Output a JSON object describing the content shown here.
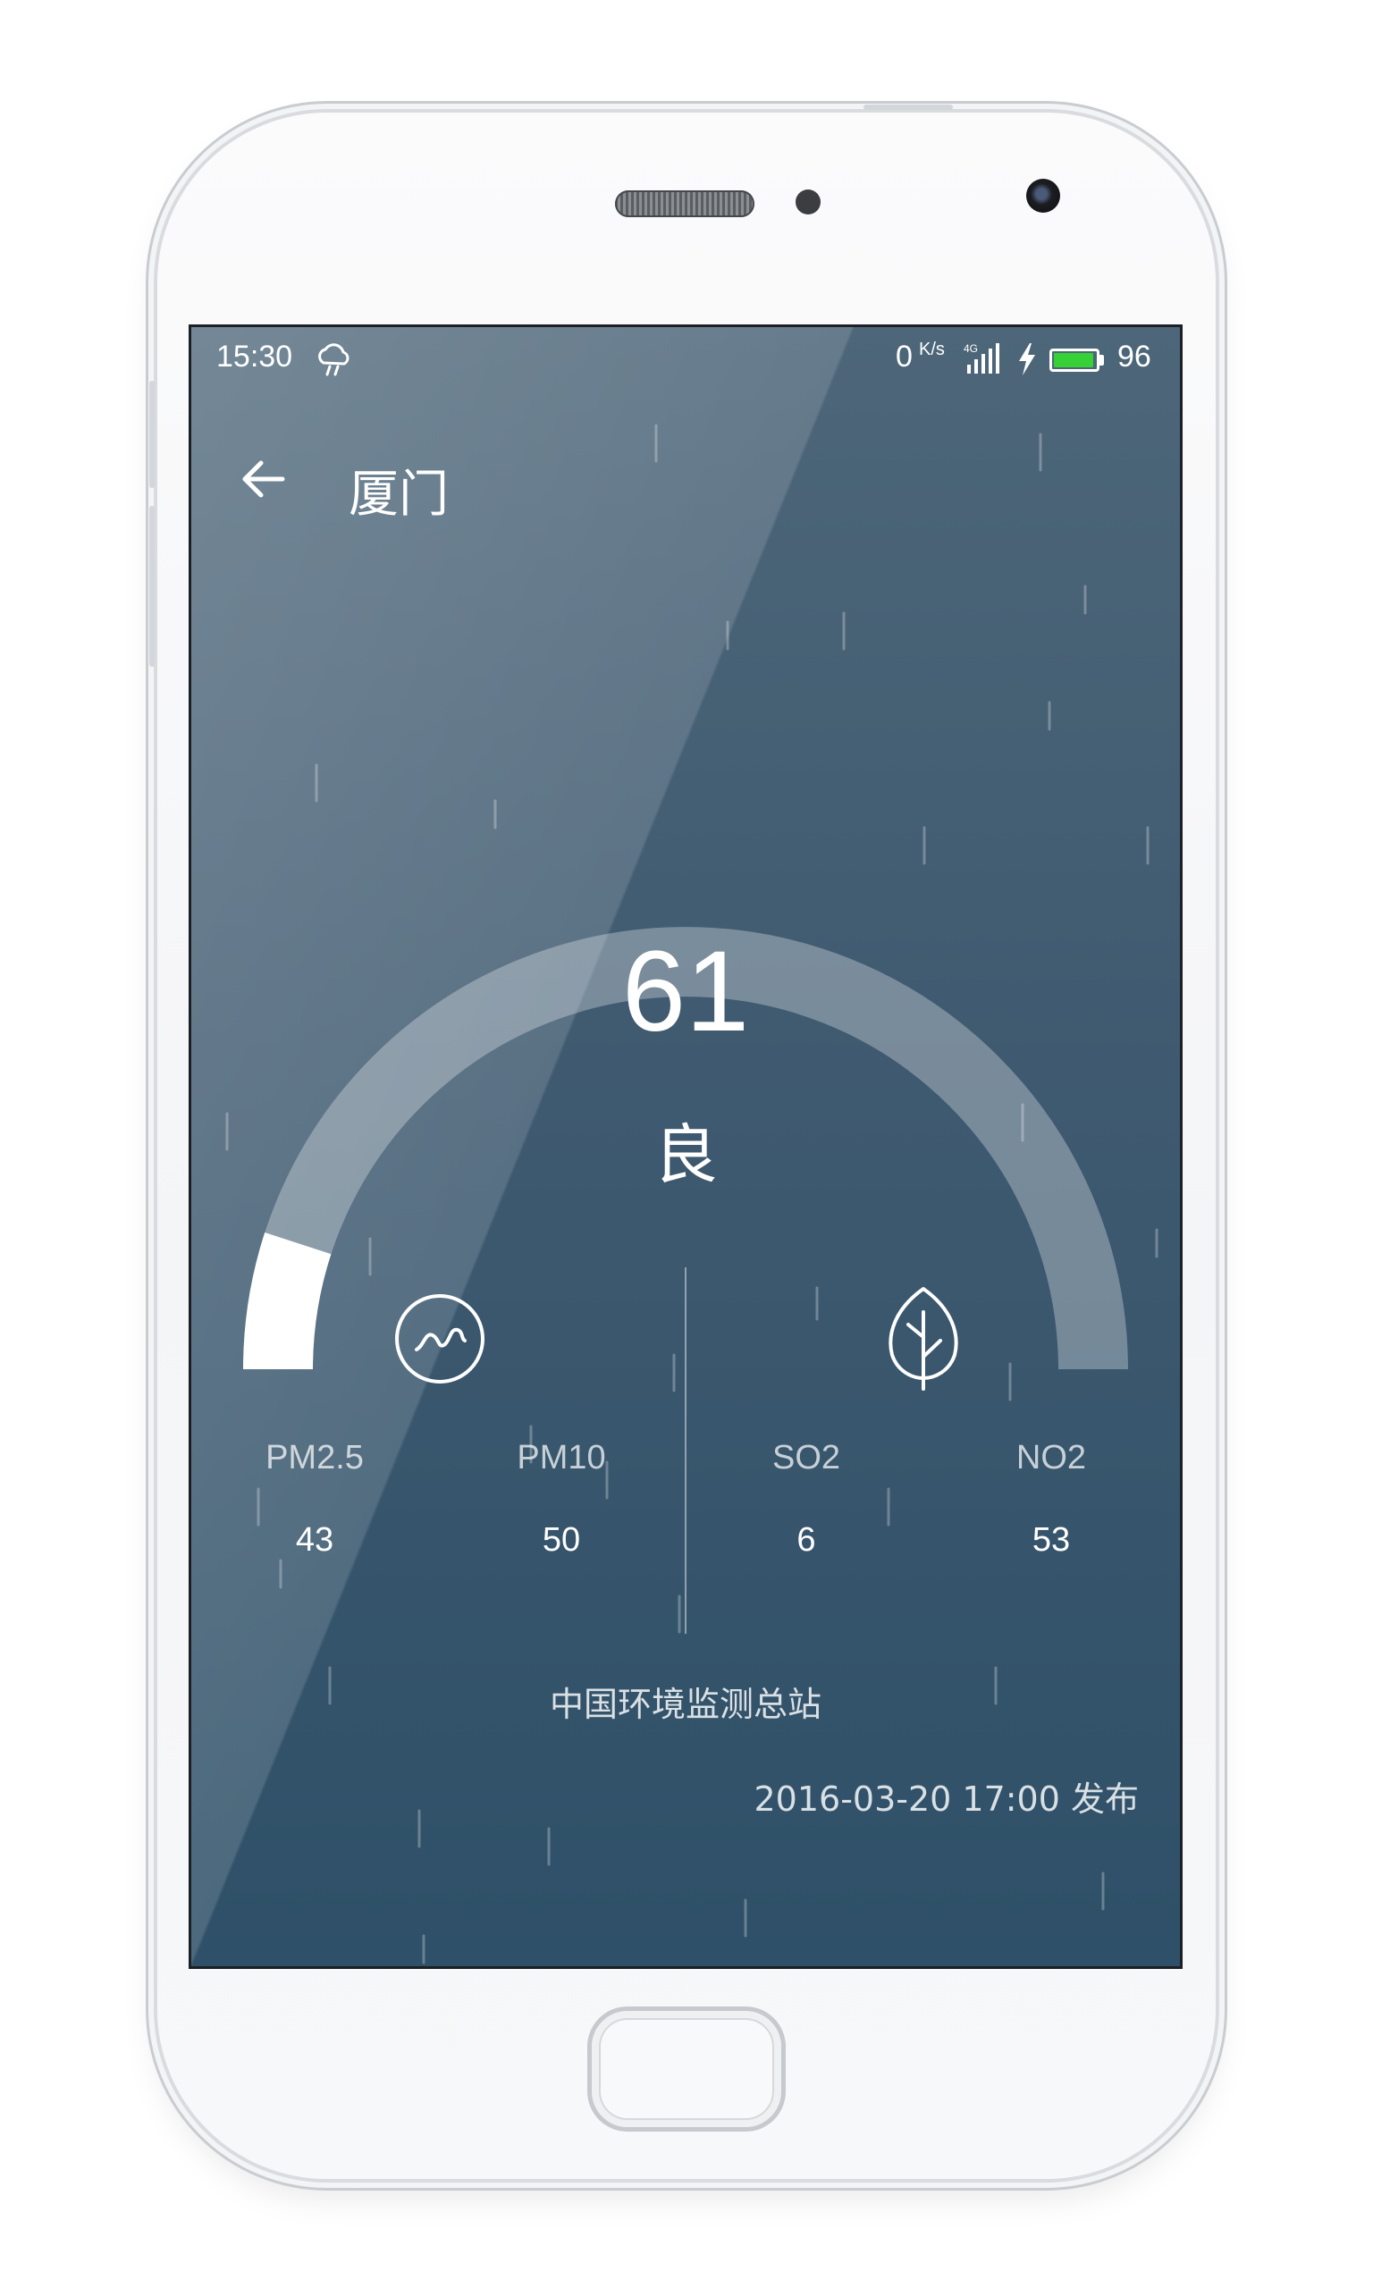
{
  "status_bar": {
    "time": "15:30",
    "weather_icon": "cloud-rain-icon",
    "net_speed": "0",
    "net_speed_unit": "K/s",
    "network_type": "4G",
    "charging_icon": "lightning-bolt-icon",
    "battery_level": "96",
    "battery_fraction": 0.96,
    "battery_color": "#35d136"
  },
  "header": {
    "back_icon": "arrow-left-icon",
    "city": "厦门"
  },
  "aqi": {
    "value": "61",
    "level": "良",
    "gauge_fraction": 0.1,
    "track_color": "#ffffff",
    "progress_color": "#ffffff"
  },
  "left_group": {
    "icon": "wave-circle-icon",
    "items": [
      {
        "name": "PM2.5",
        "value": "43"
      },
      {
        "name": "PM10",
        "value": "50"
      }
    ]
  },
  "right_group": {
    "icon": "leaf-icon",
    "items": [
      {
        "name": "SO2",
        "value": "6"
      },
      {
        "name": "NO2",
        "value": "53"
      }
    ]
  },
  "source": "中国环境监测总站",
  "publish_time": "2016-03-20 17:00 发布",
  "colors": {
    "screen_top": "#4d6679",
    "screen_bottom": "#2e5068"
  }
}
